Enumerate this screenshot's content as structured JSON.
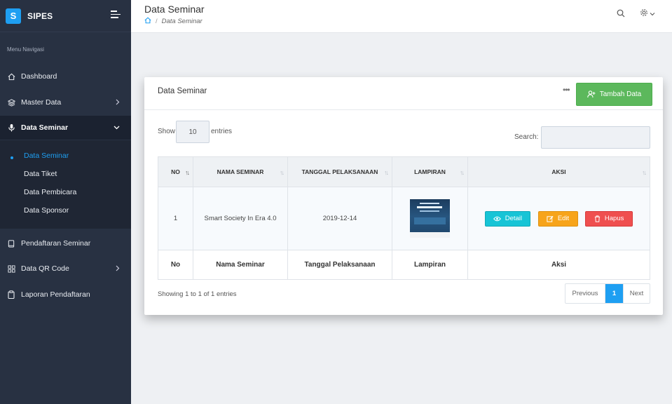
{
  "brand": {
    "logo_letter": "S",
    "name": "SIPES"
  },
  "nav": {
    "heading": "Menu Navigasi",
    "items": [
      {
        "label": "Dashboard",
        "icon": "home-icon"
      },
      {
        "label": "Master Data",
        "icon": "layers-icon"
      },
      {
        "label": "Data Seminar",
        "icon": "microphone-icon"
      },
      {
        "label": "Pendaftaran Seminar",
        "icon": "book-icon"
      },
      {
        "label": "Data QR Code",
        "icon": "grid-icon"
      },
      {
        "label": "Laporan Pendaftaran",
        "icon": "clipboard-icon"
      }
    ],
    "submenu": [
      "Data Seminar",
      "Data Tiket",
      "Data Pembicara",
      "Data Sponsor"
    ]
  },
  "header": {
    "title": "Data Seminar",
    "breadcrumb_current": "Data Seminar",
    "breadcrumb_separator": "/"
  },
  "card": {
    "title": "Data Seminar",
    "add_button": "Tambah Data",
    "menu_dots": "•••"
  },
  "table_controls": {
    "show_label": "Show",
    "page_length": "10",
    "entries_label": "entries",
    "search_label": "Search:"
  },
  "table": {
    "columns": [
      "NO",
      "NAMA SEMINAR",
      "TANGGAL PELAKSANAAN",
      "LAMPIRAN",
      "AKSI"
    ],
    "rows": [
      {
        "no": "1",
        "nama": "Smart Society In Era 4.0",
        "tanggal": "2019-12-14"
      }
    ],
    "footer": [
      "No",
      "Nama Seminar",
      "Tanggal Pelaksanaan",
      "Lampiran",
      "Aksi"
    ],
    "actions": {
      "detail": "Detail",
      "edit": "Edit",
      "hapus": "Hapus"
    }
  },
  "pagination": {
    "info": "Showing 1 to 1 of 1 entries",
    "previous": "Previous",
    "current": "1",
    "next": "Next"
  },
  "colors": {
    "sidebar": "#283142",
    "accent": "#1e9ff2",
    "add_button": "#5cb85c",
    "detail": "#17c4d6",
    "edit": "#f7a41a",
    "hapus": "#ef4f4f"
  }
}
